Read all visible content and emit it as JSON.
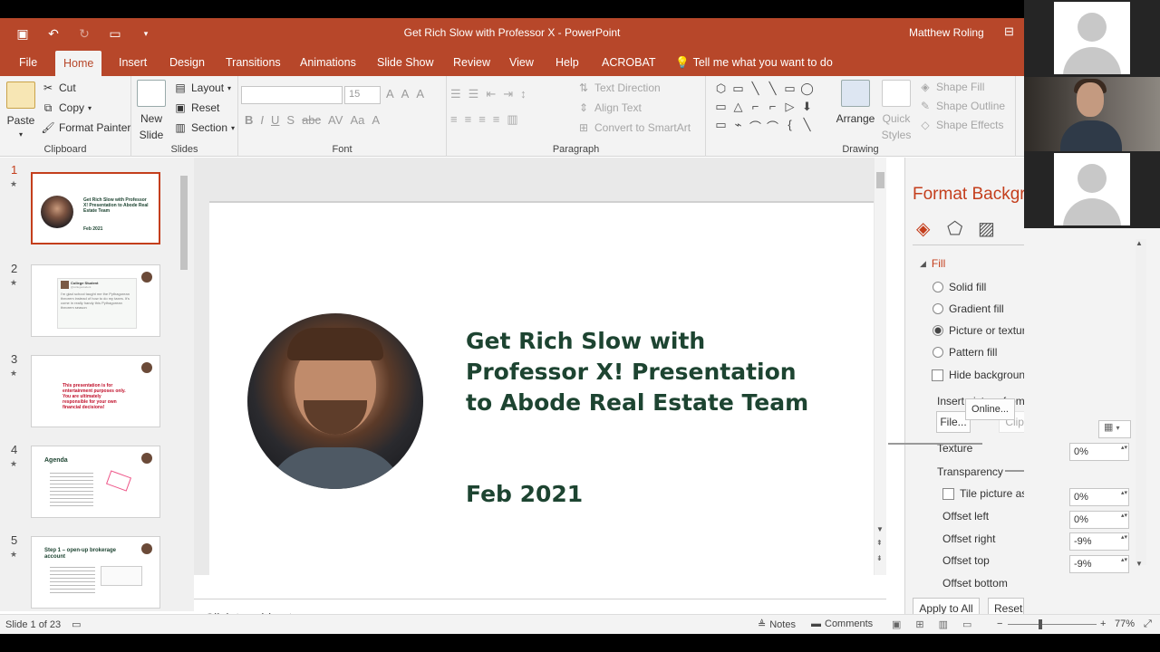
{
  "titlebar": {
    "title": "Get Rich Slow with Professor X  -  PowerPoint",
    "user": "Matthew Roling",
    "qat_icons": [
      "save-icon",
      "undo-icon",
      "redo-icon",
      "start-from-beginning-icon",
      "customize-qat-icon"
    ]
  },
  "tabs": [
    "File",
    "Home",
    "Insert",
    "Design",
    "Transitions",
    "Animations",
    "Slide Show",
    "Review",
    "View",
    "Help",
    "ACROBAT",
    "Tell me what you want to do"
  ],
  "active_tab": "Home",
  "ribbon": {
    "clipboard": {
      "label": "Clipboard",
      "paste": "Paste",
      "cut": "Cut",
      "copy": "Copy",
      "format_painter": "Format Painter"
    },
    "slides": {
      "label": "Slides",
      "new_slide_1": "New",
      "new_slide_2": "Slide",
      "layout": "Layout",
      "reset": "Reset",
      "section": "Section"
    },
    "font": {
      "label": "Font",
      "font_size": "15",
      "buttons": [
        "B",
        "I",
        "U",
        "S",
        "abc",
        "AV",
        "Aa",
        "A"
      ]
    },
    "paragraph": {
      "label": "Paragraph",
      "text_direction": "Text Direction",
      "align_text": "Align Text",
      "convert_smartart": "Convert to SmartArt"
    },
    "drawing": {
      "label": "Drawing",
      "arrange": "Arrange",
      "quick_styles_1": "Quick",
      "quick_styles_2": "Styles",
      "shape_fill": "Shape Fill",
      "shape_outline": "Shape Outline",
      "shape_effects": "Shape Effects",
      "shapes": [
        "⬡",
        "▭",
        "╲",
        "╲",
        "▭",
        "◯",
        "▭",
        "△",
        "⌐",
        "⌐",
        "▷",
        "⬇",
        "▭",
        "⌁",
        "⌒",
        "⌒",
        "{",
        "╲"
      ]
    }
  },
  "thumbnails": [
    {
      "num": "1",
      "title": "Get Rich Slow with Professor X!  Presentation to Abode Real Estate Team",
      "date": "Feb 2021"
    },
    {
      "num": "2",
      "name": "College Student",
      "handle": "@collegestudent",
      "text": "I'm glad school taught me the Pythagorean theorem instead of how to do my taxes. It's come in really handy this Pythagorean theorem season"
    },
    {
      "num": "3",
      "text": "This presentation is for entertainment purposes only.  You are ultimately responsible for your own financial decisions!"
    },
    {
      "num": "4",
      "title": "Agenda"
    },
    {
      "num": "5",
      "title": "Step 1 – open-up brokerage account"
    }
  ],
  "slide": {
    "title": "Get Rich Slow with Professor X!  Presentation to Abode Real Estate Team",
    "date": "Feb 2021"
  },
  "notes_placeholder": "Click to add notes",
  "panel": {
    "title": "Format Background",
    "section": "Fill",
    "options": [
      "Solid fill",
      "Gradient fill",
      "Picture or texture fill",
      "Pattern fill"
    ],
    "selected": "Picture or texture fill",
    "hide_bg": "Hide background graphics",
    "insert_from": "Insert picture from",
    "file_btn": "File...",
    "clipboard_btn": "Clipboard",
    "online_btn": "Online...",
    "texture": "Texture",
    "transparency": "Transparency",
    "transparency_val": "0%",
    "tile": "Tile picture as texture",
    "offset_left": "Offset left",
    "offset_left_val": "0%",
    "offset_right": "Offset right",
    "offset_right_val": "0%",
    "offset_top": "Offset top",
    "offset_top_val": "-9%",
    "offset_bottom": "Offset bottom",
    "offset_bottom_val": "-9%",
    "apply_all": "Apply to All",
    "reset_bg": "Reset Background"
  },
  "status": {
    "slide_of": "Slide 1 of 23",
    "notes": "Notes",
    "comments": "Comments",
    "zoom": "77%"
  },
  "colors": {
    "accent": "#b7472a",
    "title_green": "#1d4431",
    "selection": "#c43e1c"
  }
}
